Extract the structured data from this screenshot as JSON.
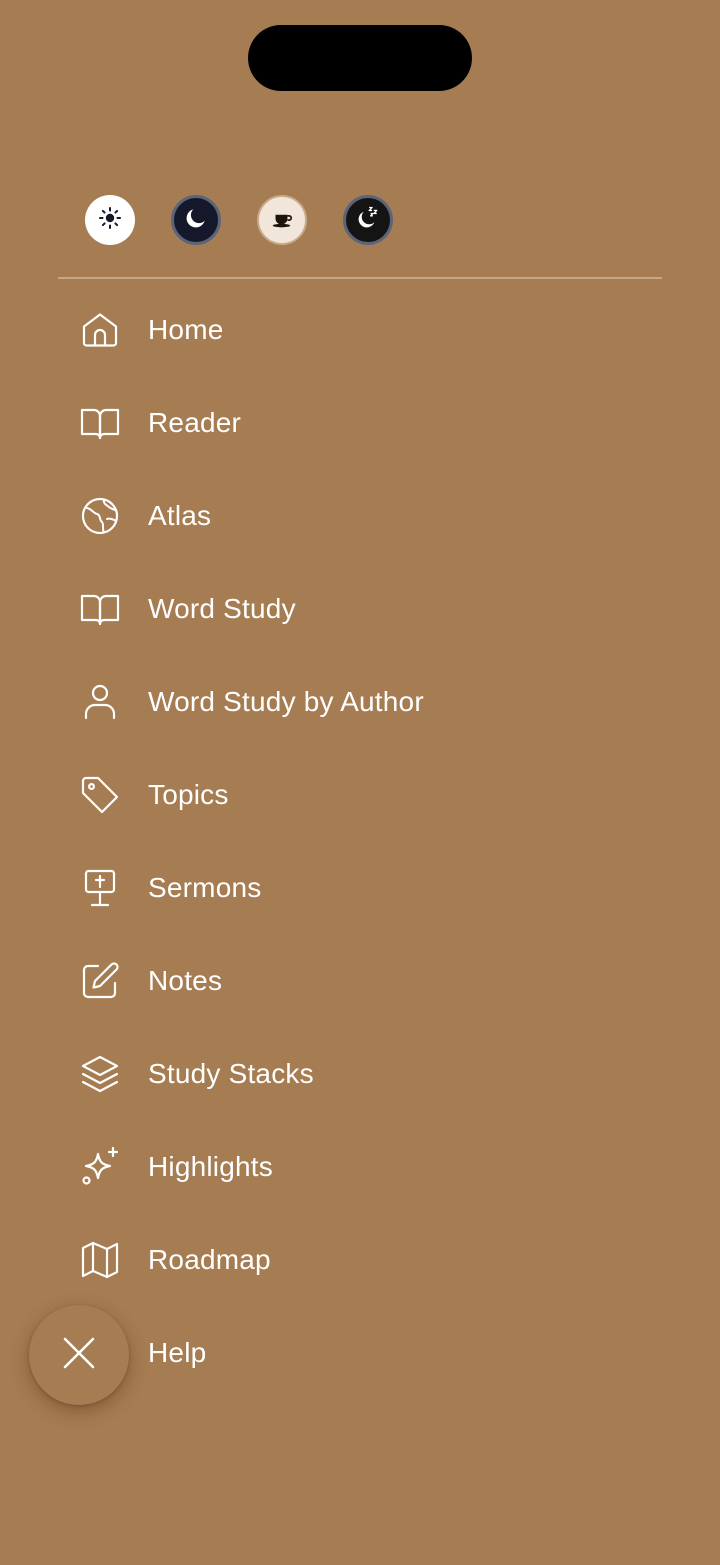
{
  "theme_options": [
    {
      "name": "light",
      "icon": "sun-icon"
    },
    {
      "name": "dark",
      "icon": "moon-icon"
    },
    {
      "name": "sepia",
      "icon": "coffee-cup-icon"
    },
    {
      "name": "night",
      "icon": "moon-zzz-icon"
    }
  ],
  "menu": {
    "items": [
      {
        "label": "Home",
        "icon": "home-icon"
      },
      {
        "label": "Reader",
        "icon": "open-book-icon"
      },
      {
        "label": "Atlas",
        "icon": "globe-icon"
      },
      {
        "label": "Word Study",
        "icon": "open-book-icon"
      },
      {
        "label": "Word Study by Author",
        "icon": "user-icon"
      },
      {
        "label": "Topics",
        "icon": "tag-icon"
      },
      {
        "label": "Sermons",
        "icon": "pulpit-icon"
      },
      {
        "label": "Notes",
        "icon": "edit-note-icon"
      },
      {
        "label": "Study Stacks",
        "icon": "layers-icon"
      },
      {
        "label": "Highlights",
        "icon": "sparkles-icon"
      },
      {
        "label": "Roadmap",
        "icon": "map-icon"
      },
      {
        "label": "Help",
        "icon": "help-icon"
      }
    ]
  },
  "close_button": {
    "icon": "close-icon"
  },
  "colors": {
    "background": "#a67c52",
    "text": "#ffffff",
    "divider": "#c6a888"
  }
}
